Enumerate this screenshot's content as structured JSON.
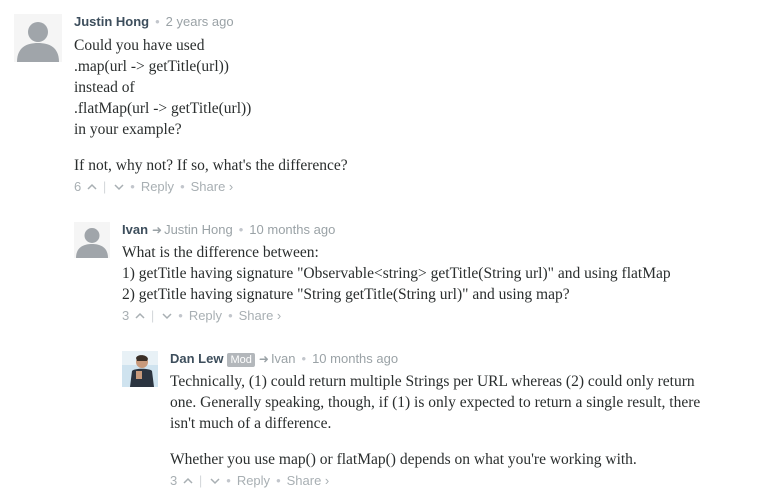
{
  "comments": [
    {
      "author": "Justin Hong",
      "time": "2 years ago",
      "paragraphs": [
        "Could you have used\n.map(url -> getTitle(url))\ninstead of\n.flatMap(url -> getTitle(url))\nin your example?",
        "If not, why not? If so, what's the difference?"
      ],
      "upvotes": "6",
      "reply_label": "Reply",
      "share_label": "Share ›"
    },
    {
      "author": "Ivan",
      "reply_to": "Justin Hong",
      "time": "10 months ago",
      "paragraphs": [
        "What is the difference between:\n1) getTitle having signature \"Observable<string> getTitle(String url)\" and using flatMap\n2) getTitle having signature \"String getTitle(String url)\" and using map?"
      ],
      "upvotes": "3",
      "reply_label": "Reply",
      "share_label": "Share ›"
    },
    {
      "author": "Dan Lew",
      "badge": "Mod",
      "reply_to": "Ivan",
      "time": "10 months ago",
      "paragraphs": [
        "Technically, (1) could return multiple Strings per URL whereas (2) could only return one. Generally speaking, though, if (1) is only expected to return a single result, there isn't much of a difference.",
        "Whether you use map() or flatMap() depends on what you're working with."
      ],
      "upvotes": "3",
      "reply_label": "Reply",
      "share_label": "Share ›"
    }
  ],
  "icons": {
    "upvote": "chevron-up-icon",
    "downvote": "chevron-down-icon",
    "reply_arrow": "reply-arrow-icon"
  },
  "colors": {
    "author": "#3d4e5c",
    "meta": "#9aa2a6",
    "body": "#2a2e2e",
    "avatar_placeholder": "#a0a5aa"
  }
}
